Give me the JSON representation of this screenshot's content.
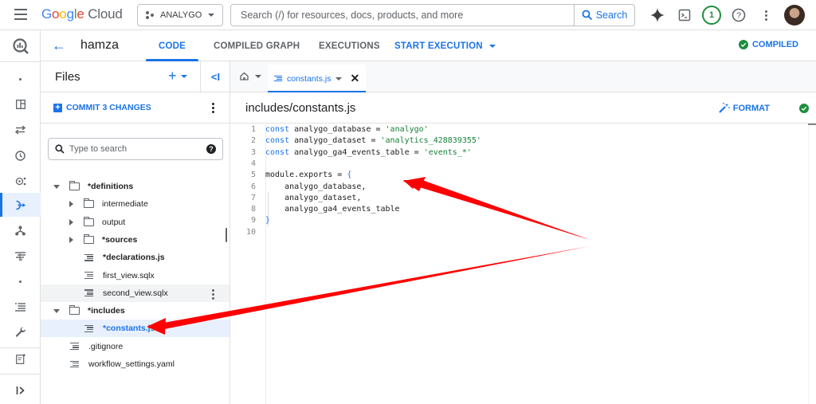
{
  "topbar": {
    "logo": {
      "g": "G",
      "o1": "o",
      "o2": "o",
      "g2": "g",
      "l": "l",
      "e": "e",
      "cloud": " Cloud"
    },
    "project": "ANALYGO",
    "search_placeholder": "Search (/) for resources, docs, products, and more",
    "search_button": "Search",
    "notifications_count": "1",
    "icons": [
      "gemini-sparkle-icon",
      "cloud-shell-icon",
      "notification-badge",
      "help-icon",
      "more-vert-icon",
      "avatar"
    ]
  },
  "rail": {
    "items": [
      "bigquery-logo",
      "dot",
      "studio",
      "transfers",
      "scheduled-queries",
      "analytics-hub",
      "dataform",
      "pipelines",
      "partner-center",
      "dot",
      "jobs-explorer",
      "settings",
      "release-notes",
      "expand"
    ],
    "active": "dataform"
  },
  "subheader": {
    "back": "←",
    "workspace": "hamza",
    "tabs": [
      {
        "label": "CODE",
        "active": true
      },
      {
        "label": "COMPILED GRAPH",
        "active": false
      },
      {
        "label": "EXECUTIONS",
        "active": false
      }
    ],
    "start_execution": "START EXECUTION",
    "status": "COMPILED",
    "status_color": "#1e8e3e"
  },
  "files": {
    "title": "Files",
    "add": "+",
    "collapse": "<I",
    "commit": "COMMIT 3 CHANGES",
    "search_placeholder": "Type to search",
    "help": "?",
    "tree": [
      {
        "name": "*definitions",
        "type": "folder",
        "expanded": true,
        "depth": 0,
        "bold": true
      },
      {
        "name": "intermediate",
        "type": "folder",
        "expanded": false,
        "depth": 1,
        "bold": false
      },
      {
        "name": "output",
        "type": "folder",
        "expanded": false,
        "depth": 1,
        "bold": false
      },
      {
        "name": "*sources",
        "type": "folder",
        "expanded": false,
        "depth": 1,
        "bold": true
      },
      {
        "name": "*declarations.js",
        "type": "file",
        "depth": 1,
        "bold": true
      },
      {
        "name": "first_view.sqlx",
        "type": "file",
        "depth": 1,
        "bold": false
      },
      {
        "name": "second_view.sqlx",
        "type": "file",
        "depth": 1,
        "bold": false,
        "hover": true
      },
      {
        "name": "*includes",
        "type": "folder",
        "expanded": true,
        "depth": 0,
        "bold": true
      },
      {
        "name": "*constants.js",
        "type": "file",
        "depth": 1,
        "bold": true,
        "selected": true
      },
      {
        "name": ".gitignore",
        "type": "file",
        "depth": 0,
        "bold": false
      },
      {
        "name": "workflow_settings.yaml",
        "type": "file",
        "depth": 0,
        "bold": false
      }
    ]
  },
  "editor": {
    "tab_label": "constants.js",
    "path": "includes/constants.js",
    "format": "FORMAT",
    "lines": [
      {
        "n": "1",
        "tokens": [
          [
            "kw",
            "const"
          ],
          [
            "",
            " analygo_database = "
          ],
          [
            "str",
            "'analygo'"
          ]
        ]
      },
      {
        "n": "2",
        "tokens": [
          [
            "kw",
            "const"
          ],
          [
            "",
            " analygo_dataset = "
          ],
          [
            "str",
            "'analytics_428839355'"
          ]
        ]
      },
      {
        "n": "3",
        "tokens": [
          [
            "kw",
            "const"
          ],
          [
            "",
            " analygo_ga4_events_table = "
          ],
          [
            "str",
            "'events_*'"
          ]
        ]
      },
      {
        "n": "4",
        "tokens": []
      },
      {
        "n": "5",
        "tokens": [
          [
            "",
            "module.exports = "
          ],
          [
            "br",
            "{"
          ]
        ]
      },
      {
        "n": "6",
        "tokens": [
          [
            "",
            "    analygo_database,"
          ]
        ]
      },
      {
        "n": "7",
        "tokens": [
          [
            "",
            "    analygo_dataset,"
          ]
        ]
      },
      {
        "n": "8",
        "tokens": [
          [
            "",
            "    analygo_ga4_events_table"
          ]
        ]
      },
      {
        "n": "9",
        "tokens": [
          [
            "br",
            "}"
          ]
        ]
      },
      {
        "n": "10",
        "tokens": []
      }
    ]
  },
  "annotations": {
    "color": "#ff0000",
    "arrows": [
      {
        "from": "right-of-code",
        "to": "module.exports line"
      },
      {
        "from": "right-of-code",
        "to": "*constants.js tree item"
      }
    ]
  }
}
